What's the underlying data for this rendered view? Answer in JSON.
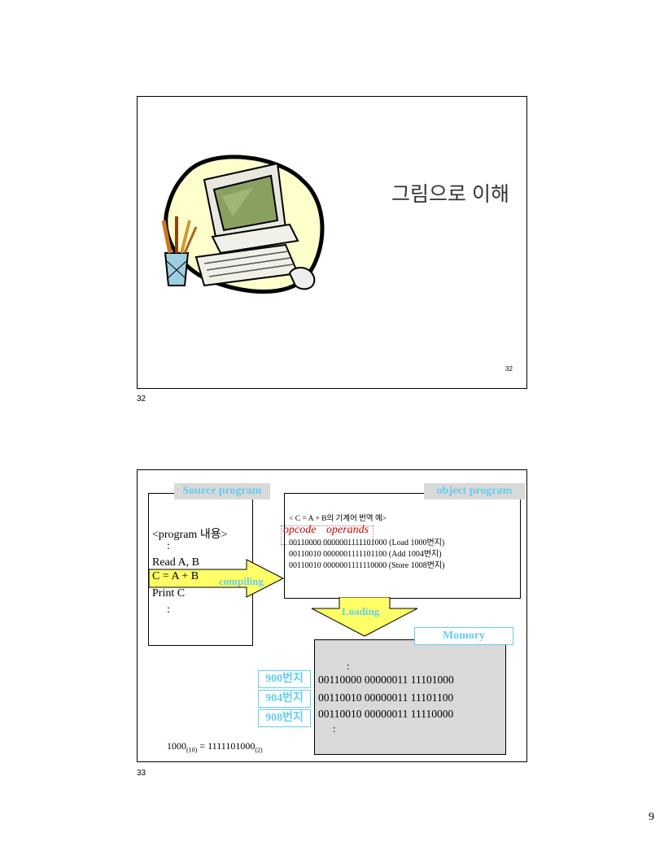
{
  "slide1": {
    "title": "그림으로 이해",
    "slide_number": "32",
    "page_label": "32",
    "clipart": "computer-clipart"
  },
  "slide2": {
    "page_label": "33",
    "source": {
      "tag": "Source program",
      "lines": [
        "<program 내용>",
        ":",
        "Read A, B",
        "C = A + B",
        "Print C",
        ":"
      ]
    },
    "compiling": "compiling",
    "object": {
      "tag": "object program",
      "heading": "< C = A + B의 기계어 번역 예>",
      "opcode": "opcode",
      "operands": "operands",
      "lines": [
        "00110000 0000001111101000 (Load 1000번지)",
        "00110010 0000001111101100 (Add 1004번지)",
        "00110010 0000001111110000 (Store 1008번지)"
      ]
    },
    "loading": "Loading",
    "memory": {
      "tag": "Momory",
      "dots_top": ":",
      "rows": [
        {
          "addr": "900번지",
          "value": "00110000 00000011 11101000"
        },
        {
          "addr": "904번지",
          "value": "00110010 00000011 11101100"
        },
        {
          "addr": "908번지",
          "value": "00110010 00000011 11110000"
        }
      ],
      "dots_bottom": ":"
    },
    "formula": {
      "lhs": "1000",
      "lhs_sub": "(10)",
      "eq": " = ",
      "rhs": "1111101000",
      "rhs_sub": "(2)"
    },
    "colors": {
      "accent": "#66ccee",
      "arrow": "#ffff66",
      "highlight": "#ffff66",
      "memory_bg": "#d9d9d9",
      "opcode": "#cc0000"
    }
  },
  "page_number": "9"
}
